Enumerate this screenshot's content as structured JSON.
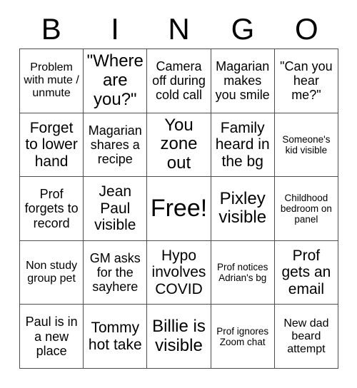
{
  "header": {
    "letters": [
      "B",
      "I",
      "N",
      "G",
      "O"
    ]
  },
  "grid": {
    "rows": 5,
    "columns": 5,
    "cells": [
      {
        "text": "Problem with mute / unmute",
        "size": "sm"
      },
      {
        "text": "\"Where are you?\"",
        "size": "xl"
      },
      {
        "text": "Camera off during cold call",
        "size": "md"
      },
      {
        "text": "Magarian makes you smile",
        "size": "md"
      },
      {
        "text": "\"Can you hear me?\"",
        "size": "md"
      },
      {
        "text": "Forget to lower hand",
        "size": "lg"
      },
      {
        "text": "Magarian shares a recipe",
        "size": "md"
      },
      {
        "text": "You zone out",
        "size": "xl"
      },
      {
        "text": "Family heard in the bg",
        "size": "lg"
      },
      {
        "text": "Someone's kid visible",
        "size": "xs"
      },
      {
        "text": "Prof forgets to record",
        "size": "md"
      },
      {
        "text": "Jean Paul visible",
        "size": "lg"
      },
      {
        "text": "Free!",
        "size": "xxl"
      },
      {
        "text": "Pixley visible",
        "size": "xl"
      },
      {
        "text": "Childhood bedroom on panel",
        "size": "xs"
      },
      {
        "text": "Non study group pet",
        "size": "sm"
      },
      {
        "text": "GM asks for the sayhere",
        "size": "md"
      },
      {
        "text": "Hypo involves COVID",
        "size": "lg"
      },
      {
        "text": "Prof notices Adrian's bg",
        "size": "xs"
      },
      {
        "text": "Prof gets an email",
        "size": "lg"
      },
      {
        "text": "Paul is in a new place",
        "size": "md"
      },
      {
        "text": "Tommy hot take",
        "size": "lg"
      },
      {
        "text": "Billie is visible",
        "size": "xl"
      },
      {
        "text": "Prof ignores Zoom chat",
        "size": "xs"
      },
      {
        "text": "New dad beard attempt",
        "size": "sm"
      }
    ]
  },
  "colors": {
    "background": "#ffffff",
    "text": "#000000",
    "grid_line": "#4d4d4d"
  }
}
